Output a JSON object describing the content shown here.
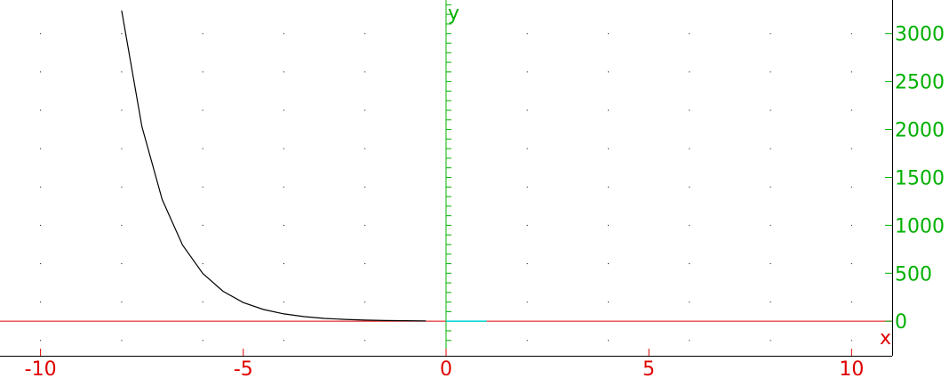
{
  "chart_data": {
    "type": "line",
    "title": "",
    "xlabel": "x",
    "ylabel": "y",
    "xlim": [
      -11,
      11
    ],
    "ylim": [
      -360,
      3350
    ],
    "x_ticks": [
      -10,
      -5,
      0,
      5,
      10
    ],
    "x_tick_labels": [
      "-10",
      "-5",
      "0",
      "5",
      "10"
    ],
    "y_ticks": [
      0,
      500,
      1000,
      1500,
      2000,
      2500,
      3000
    ],
    "y_tick_labels": [
      "0",
      "500",
      "1000",
      "1500",
      "2000",
      "2500",
      "3000"
    ],
    "grid": "dotted",
    "colors": {
      "x_axis": "#e00000",
      "y_axis": "#00b000",
      "curve": "#000000",
      "segment": "#00d8d8",
      "frame": "#000000"
    },
    "series": [
      {
        "x": [
          -8.0,
          -7.5,
          -7.0,
          -6.5,
          -6.0,
          -5.5,
          -5.0,
          -4.5,
          -4.0,
          -3.5,
          -3.0,
          -2.5,
          -2.0,
          -1.5,
          -1.0,
          -0.5
        ],
        "y": [
          3240,
          2030,
          1270,
          795,
          498,
          312,
          195,
          122,
          77,
          48,
          30,
          19,
          12,
          7,
          5,
          3
        ]
      }
    ],
    "segment": {
      "x": [
        0,
        1
      ],
      "y": [
        0,
        0
      ]
    }
  }
}
